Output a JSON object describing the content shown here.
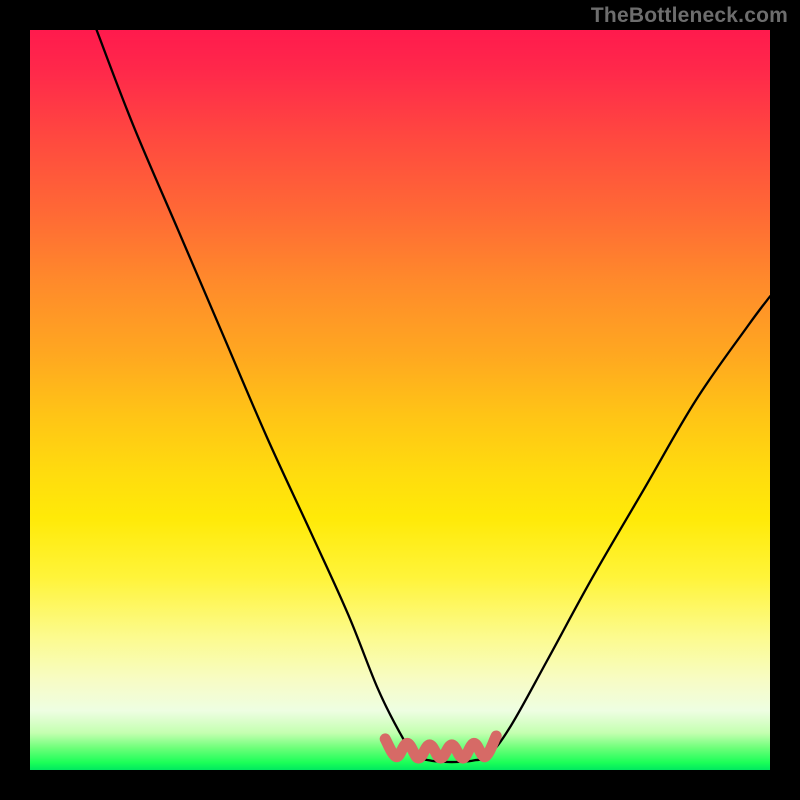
{
  "watermark": "TheBottleneck.com",
  "chart_data": {
    "type": "line",
    "title": "",
    "xlabel": "",
    "ylabel": "",
    "xlim": [
      0,
      100
    ],
    "ylim": [
      0,
      100
    ],
    "series": [
      {
        "name": "bottleneck-curve",
        "x": [
          9,
          14,
          20,
          26,
          32,
          38,
          43,
          47,
          50,
          52,
          54,
          56,
          58,
          60,
          62,
          65,
          70,
          76,
          83,
          90,
          97,
          100
        ],
        "values": [
          100,
          87,
          73,
          59,
          45,
          32,
          21,
          11,
          5,
          2,
          1.3,
          1.1,
          1.1,
          1.3,
          2,
          6,
          15,
          26,
          38,
          50,
          60,
          64
        ]
      },
      {
        "name": "bottom-squiggle",
        "x": [
          48,
          49.5,
          51,
          52.5,
          54,
          55.5,
          57,
          58.5,
          60,
          61.5,
          63
        ],
        "values": [
          4.2,
          1.8,
          3.6,
          1.6,
          3.4,
          1.6,
          3.4,
          1.6,
          3.6,
          1.8,
          4.6
        ]
      }
    ],
    "colors": {
      "curve": "#000000",
      "squiggle": "#d66a66"
    }
  }
}
